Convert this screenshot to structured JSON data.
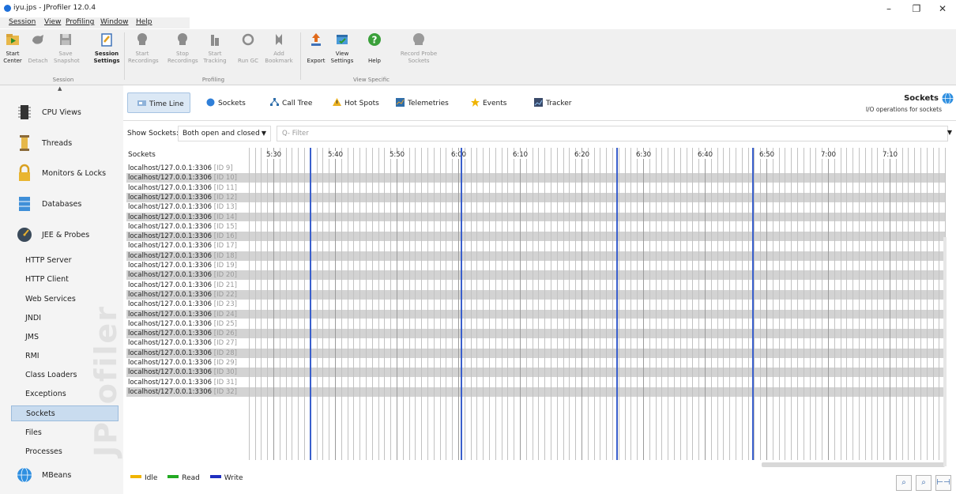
{
  "window": {
    "title": "iyu.jps - JProfiler 12.0.4",
    "controls": [
      "–",
      "❐",
      "✕"
    ]
  },
  "menu": [
    "Session",
    "View",
    "Profiling",
    "Window",
    "Help"
  ],
  "toolbar": {
    "buttons": [
      {
        "line1": "Start",
        "line2": "Center",
        "enabled": true,
        "icon": "start-center-icon"
      },
      {
        "line1": "Detach",
        "line2": "",
        "enabled": false,
        "icon": "detach-icon"
      },
      {
        "line1": "Save",
        "line2": "Snapshot",
        "enabled": false,
        "icon": "save-snapshot-icon"
      },
      {
        "line1": "Session",
        "line2": "Settings",
        "enabled": true,
        "icon": "session-settings-icon"
      },
      {
        "line1": "Start",
        "line2": "Recordings",
        "enabled": false,
        "icon": "start-recordings-icon"
      },
      {
        "line1": "Stop",
        "line2": "Recordings",
        "enabled": false,
        "icon": "stop-recordings-icon"
      },
      {
        "line1": "Start",
        "line2": "Tracking",
        "enabled": false,
        "icon": "start-tracking-icon"
      },
      {
        "line1": "Run GC",
        "line2": "",
        "enabled": false,
        "icon": "run-gc-icon"
      },
      {
        "line1": "Add",
        "line2": "Bookmark",
        "enabled": false,
        "icon": "add-bookmark-icon"
      },
      {
        "line1": "Export",
        "line2": "",
        "enabled": true,
        "icon": "export-icon"
      },
      {
        "line1": "View",
        "line2": "Settings",
        "enabled": true,
        "icon": "view-settings-icon"
      },
      {
        "line1": "Help",
        "line2": "",
        "enabled": true,
        "icon": "help-icon"
      },
      {
        "line1": "Record Probe",
        "line2": "Sockets",
        "enabled": false,
        "icon": "record-probe-icon"
      }
    ],
    "groups": [
      "Session",
      "Profiling",
      "View Specific"
    ]
  },
  "sidebar": {
    "sections": [
      {
        "label": "CPU Views",
        "icon": "cpu-views-icon"
      },
      {
        "label": "Threads",
        "icon": "threads-icon"
      },
      {
        "label": "Monitors & Locks",
        "icon": "monitors-locks-icon"
      },
      {
        "label": "Databases",
        "icon": "databases-icon"
      },
      {
        "label": "JEE & Probes",
        "icon": "jee-probes-icon"
      }
    ],
    "probes": [
      "HTTP Server",
      "HTTP Client",
      "Web Services",
      "JNDI",
      "JMS",
      "RMI",
      "Class Loaders",
      "Exceptions",
      "Sockets",
      "Files",
      "Processes"
    ],
    "selected_probe": "Sockets",
    "mbeans": "MBeans",
    "watermark": "JProfiler"
  },
  "view_tabs": [
    {
      "label": "Time Line",
      "active": true,
      "icon": "timeline-icon"
    },
    {
      "label": "Sockets",
      "active": false,
      "icon": "sockets-icon"
    },
    {
      "label": "Call Tree",
      "active": false,
      "icon": "call-tree-icon"
    },
    {
      "label": "Hot Spots",
      "active": false,
      "icon": "hot-spots-icon"
    },
    {
      "label": "Telemetries",
      "active": false,
      "icon": "telemetries-icon"
    },
    {
      "label": "Events",
      "active": false,
      "icon": "events-icon"
    },
    {
      "label": "Tracker",
      "active": false,
      "icon": "tracker-icon"
    }
  ],
  "header": {
    "title": "Sockets",
    "subtitle": "I/O operations for sockets"
  },
  "filter": {
    "show_label": "Show Sockets:",
    "show_value": "Both open and closed",
    "placeholder": "Q- Filter"
  },
  "timeline": {
    "column_header": "Sockets",
    "time_labels": [
      "5:30",
      "5:40",
      "5:50",
      "6:00",
      "6:10",
      "6:20",
      "6:30",
      "6:40",
      "6:50",
      "7:00",
      "7:10"
    ],
    "rows": [
      {
        "host": "localhost/127.0.0.1:3306",
        "id": "[ID 9]"
      },
      {
        "host": "localhost/127.0.0.1:3306",
        "id": "[ID 10]"
      },
      {
        "host": "localhost/127.0.0.1:3306",
        "id": "[ID 11]"
      },
      {
        "host": "localhost/127.0.0.1:3306",
        "id": "[ID 12]"
      },
      {
        "host": "localhost/127.0.0.1:3306",
        "id": "[ID 13]"
      },
      {
        "host": "localhost/127.0.0.1:3306",
        "id": "[ID 14]"
      },
      {
        "host": "localhost/127.0.0.1:3306",
        "id": "[ID 15]"
      },
      {
        "host": "localhost/127.0.0.1:3306",
        "id": "[ID 16]"
      },
      {
        "host": "localhost/127.0.0.1:3306",
        "id": "[ID 17]"
      },
      {
        "host": "localhost/127.0.0.1:3306",
        "id": "[ID 18]"
      },
      {
        "host": "localhost/127.0.0.1:3306",
        "id": "[ID 19]"
      },
      {
        "host": "localhost/127.0.0.1:3306",
        "id": "[ID 20]"
      },
      {
        "host": "localhost/127.0.0.1:3306",
        "id": "[ID 21]"
      },
      {
        "host": "localhost/127.0.0.1:3306",
        "id": "[ID 22]"
      },
      {
        "host": "localhost/127.0.0.1:3306",
        "id": "[ID 23]"
      },
      {
        "host": "localhost/127.0.0.1:3306",
        "id": "[ID 24]"
      },
      {
        "host": "localhost/127.0.0.1:3306",
        "id": "[ID 25]"
      },
      {
        "host": "localhost/127.0.0.1:3306",
        "id": "[ID 26]"
      },
      {
        "host": "localhost/127.0.0.1:3306",
        "id": "[ID 27]"
      },
      {
        "host": "localhost/127.0.0.1:3306",
        "id": "[ID 28]"
      },
      {
        "host": "localhost/127.0.0.1:3306",
        "id": "[ID 29]"
      },
      {
        "host": "localhost/127.0.0.1:3306",
        "id": "[ID 30]"
      },
      {
        "host": "localhost/127.0.0.1:3306",
        "id": "[ID 31]"
      },
      {
        "host": "localhost/127.0.0.1:3306",
        "id": "[ID 32]"
      }
    ],
    "write_color": "#3a5fcc"
  },
  "legend": [
    {
      "label": "Idle",
      "color": "#f0b400"
    },
    {
      "label": "Read",
      "color": "#22aa22"
    },
    {
      "label": "Write",
      "color": "#1f2fc0"
    }
  ],
  "colors": {
    "accent": "#1e6fd9",
    "selected_bg": "#c9dcef"
  }
}
